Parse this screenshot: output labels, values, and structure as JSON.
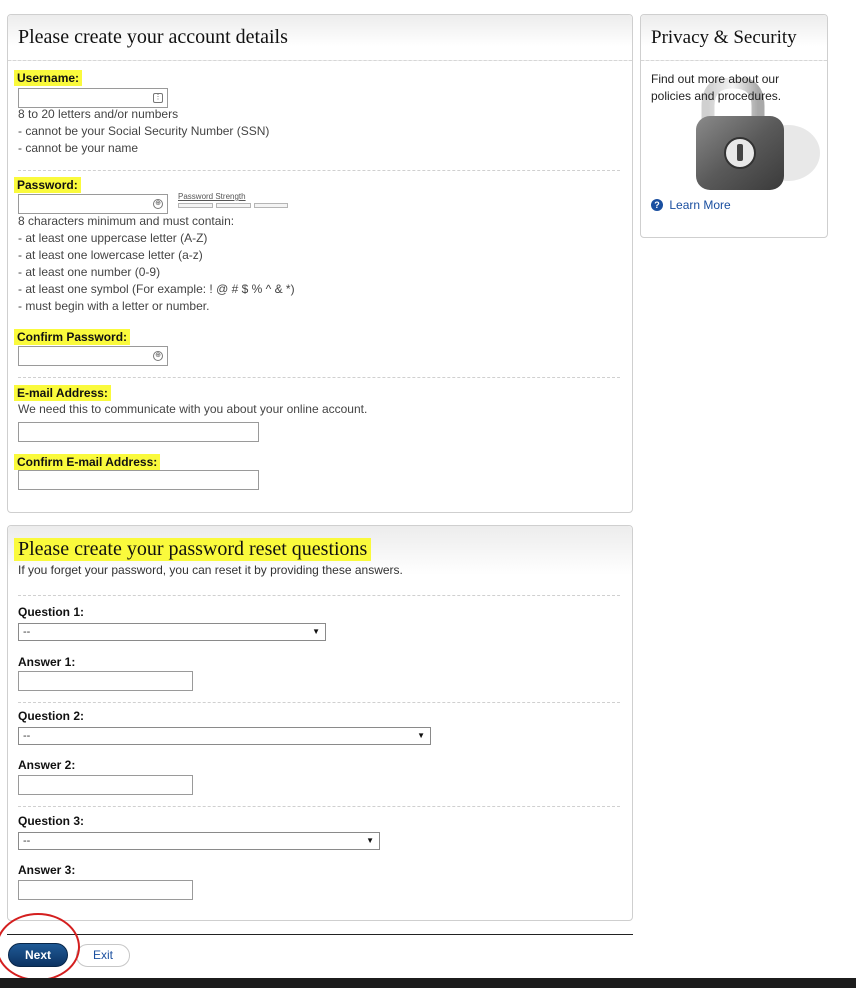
{
  "account": {
    "title": "Please create your account details",
    "username_label": "Username:",
    "username_hints": [
      "8 to 20 letters and/or numbers",
      "- cannot be your Social Security Number (SSN)",
      "- cannot be your name"
    ],
    "password_label": "Password:",
    "password_strength_label": "Password Strength",
    "password_hints": [
      "8 characters minimum and must contain:",
      "- at least one uppercase letter (A-Z)",
      "- at least one lowercase letter (a-z)",
      "- at least one number (0-9)",
      "- at least one symbol (For example: ! @ # $ % ^ & *)",
      "- must begin with a letter or number."
    ],
    "confirm_password_label": "Confirm Password:",
    "email_label": "E-mail Address:",
    "email_hint": "We need this to communicate with you about your online account.",
    "confirm_email_label": "Confirm E-mail Address:"
  },
  "reset": {
    "title": "Please create your password reset questions",
    "subtitle": "If you forget your password, you can reset it by providing these answers.",
    "question1_label": "Question 1:",
    "question1_value": "--",
    "answer1_label": "Answer 1:",
    "question2_label": "Question 2:",
    "question2_value": "--",
    "answer2_label": "Answer 2:",
    "question3_label": "Question 3:",
    "question3_value": "--",
    "answer3_label": "Answer 3:"
  },
  "privacy": {
    "title": "Privacy & Security",
    "text_line1": "Find out more about our",
    "text_line2": "policies and procedures.",
    "learn_more": "Learn More"
  },
  "actions": {
    "next": "Next",
    "exit": "Exit"
  },
  "colors": {
    "highlight": "#fafa3c",
    "primary_button": "#0c3363",
    "link": "#1a4fa0",
    "annotation_circle": "#d41f1f"
  }
}
